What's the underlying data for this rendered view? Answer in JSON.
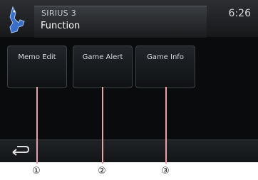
{
  "header": {
    "source_name": "SIRIUS 3",
    "title": "Function",
    "time": "6:26"
  },
  "buttons": [
    {
      "label": "Memo Edit",
      "callout": "①"
    },
    {
      "label": "Game Alert",
      "callout": "②"
    },
    {
      "label": "Game Info",
      "callout": "③"
    }
  ],
  "colors": {
    "screen_background": "#0a0b0c",
    "callout_line": "#e8a0a8",
    "icon_blue": "#3a6fc9"
  },
  "icons": {
    "source": "sirius-dog-icon",
    "back": "back-arrow-icon"
  }
}
